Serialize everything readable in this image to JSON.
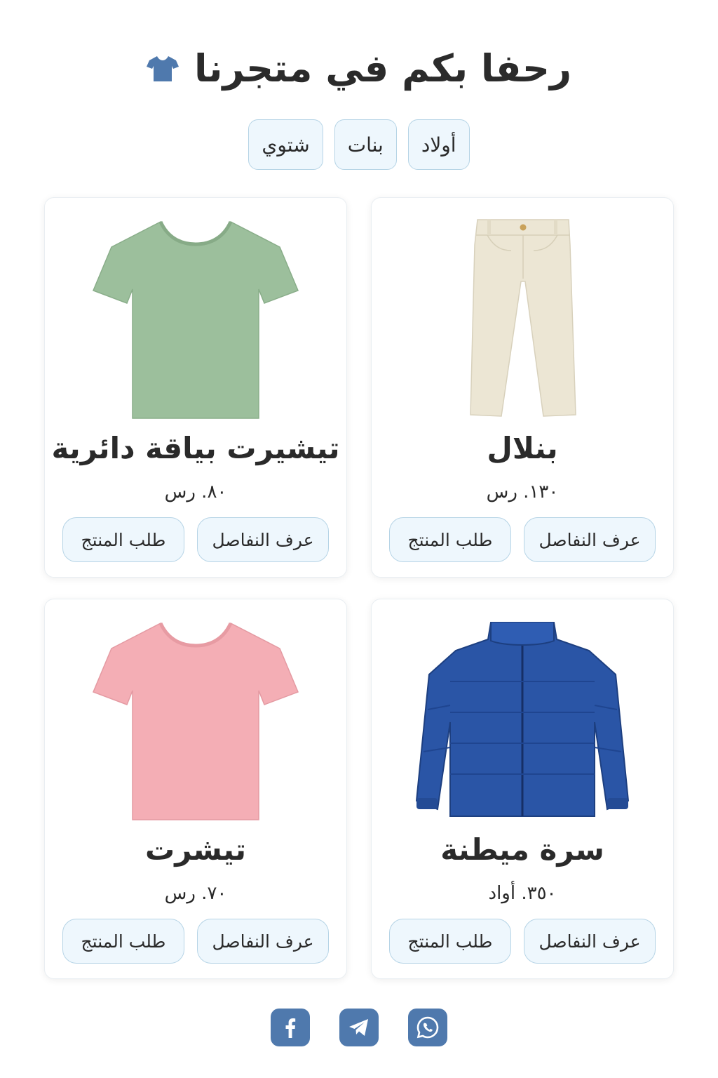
{
  "header": {
    "title": "رحفا بكم في متجرنا",
    "icon": "tshirt-icon",
    "icon_color": "#4f79ad"
  },
  "categories": [
    {
      "label": "أولاد"
    },
    {
      "label": "بنات"
    },
    {
      "label": "شتوي"
    }
  ],
  "products": [
    {
      "name": "بنلال",
      "price": "١٣٠. رس",
      "image": "beige-pants-image",
      "color": "#ece6d4"
    },
    {
      "name": "تيشيرت بياقة دائرية",
      "price": "٨٠. رس",
      "image": "green-tshirt-image",
      "color": "#9cbf9c"
    },
    {
      "name": "سرة ميطنة",
      "price": "٣٥٠. أواد",
      "image": "blue-puffer-jacket-image",
      "color": "#2a55a6"
    },
    {
      "name": "تيشرت",
      "price": "٧٠. رس",
      "image": "pink-tshirt-image",
      "color": "#f4aeb5"
    }
  ],
  "buttons": {
    "details": "عرف النفاصل",
    "order": "طلب المنتج"
  },
  "social": [
    {
      "icon": "whatsapp-icon"
    },
    {
      "icon": "telegram-icon"
    },
    {
      "icon": "facebook-icon"
    }
  ],
  "colors": {
    "accent": "#4f79ad",
    "button_bg": "#eef7fd",
    "button_border": "#b6d4e6"
  }
}
